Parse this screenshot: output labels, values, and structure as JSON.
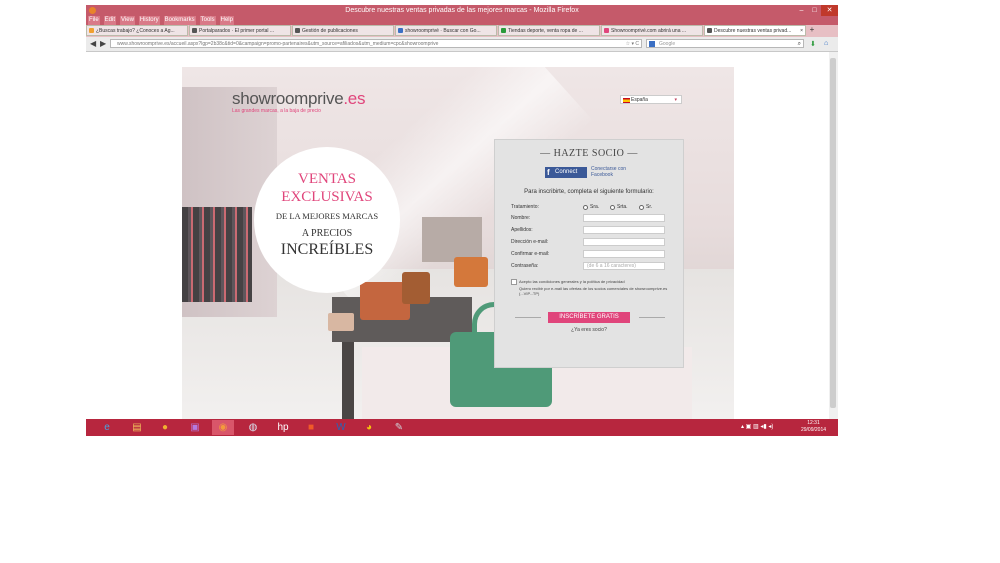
{
  "window": {
    "title": "Descubre nuestras ventas privadas de las mejores marcas - Mozilla Firefox",
    "controls": {
      "minimize": "–",
      "maximize": "□",
      "close": "✕"
    }
  },
  "menu": [
    "File",
    "Edit",
    "View",
    "History",
    "Bookmarks",
    "Tools",
    "Help"
  ],
  "tabs": [
    {
      "label": "¿Buscas trabajo? ¿Conoces a Ag...",
      "icon_color": "#f0a030",
      "active": false
    },
    {
      "label": "Portalparados · El primer portal ...",
      "icon_color": "#555555",
      "active": false
    },
    {
      "label": "Gestión de publicaciones",
      "icon_color": "#555555",
      "active": false
    },
    {
      "label": "showroomprivé · Buscar con Go...",
      "icon_color": "#3b6fc4",
      "active": false
    },
    {
      "label": "Tiendas deporte, venta ropa de ...",
      "icon_color": "#2a9a3a",
      "active": false
    },
    {
      "label": "Showroomprivé.com abrirá una ...",
      "icon_color": "#e0457b",
      "active": false
    },
    {
      "label": "Descubre nuestras ventas privad...",
      "icon_color": "#555555",
      "active": true
    }
  ],
  "tab_close": "×",
  "tab_new": "+",
  "nav": {
    "back": "◀",
    "forward": "▶",
    "url": "www.showroomprive.es/accueil.aspx?lgp=2b38c&tid=0&campaign=promo-partenaires&utm_source=afiliados&utm_medium=cpc&showroomprive",
    "url_right": "☆ ▾ C",
    "search_placeholder": "Google",
    "search_icon": "magnifier-icon",
    "magnifier": "⌕",
    "download": "⬇",
    "home": "⌂"
  },
  "page": {
    "logo_text": "showroomprive",
    "logo_suffix": ".es",
    "logo_tagline": "Las grandes marcas, a la baja de precio",
    "language": "España",
    "language_caret": "▾",
    "promo": {
      "line1": "VENTAS",
      "line2": "EXCLUSIVAS",
      "line3": "DE LA MEJORES MARCAS",
      "line4": "A PRECIOS",
      "line5": "INCREÍBLES"
    },
    "signup": {
      "title": "— HAZTE SOCIO —",
      "fb_icon": "f",
      "fb_button": "Connect",
      "fb_text": "Conectarse con Facebook",
      "subtitle": "Para inscribirte, completa el siguiente formulario:",
      "treatment_label": "Tratamiento:",
      "treatment_options": [
        "Sra.",
        "Srta.",
        "Sr."
      ],
      "name_label": "Nombre:",
      "surname_label": "Apellidos:",
      "email_label": "Dirección e-mail:",
      "email_confirm_label": "Confirmar e-mail:",
      "password_label": "Contraseña:",
      "password_placeholder": "(de 6 a 16 caracteres)",
      "legal_text": "Acepto las condiciones generales y la política de privacidad",
      "promo_text": "Quiero recibir por e-mail las ofertas de los socios comerciales de showroomprive.es (...VIP...TP)",
      "submit": "INSCRÍBETE GRATIS",
      "member_link": "¿Ya eres socio?"
    }
  },
  "taskbar": {
    "apps": [
      {
        "name": "ie-icon",
        "glyph": "e",
        "color": "#4aa3df"
      },
      {
        "name": "explorer-icon",
        "glyph": "▤",
        "color": "#f2c55c"
      },
      {
        "name": "media-icon",
        "glyph": "●",
        "color": "#f0b030"
      },
      {
        "name": "chat-icon",
        "glyph": "▣",
        "color": "#b57adf"
      },
      {
        "name": "firefox-icon",
        "glyph": "◉",
        "color": "#f39a3d"
      },
      {
        "name": "steam-icon",
        "glyph": "◍",
        "color": "#d9e3ef"
      },
      {
        "name": "hp-icon",
        "glyph": "hp",
        "color": "#ffffff"
      },
      {
        "name": "office-icon",
        "glyph": "■",
        "color": "#f05a28"
      },
      {
        "name": "word-icon",
        "glyph": "W",
        "color": "#2b63b5"
      },
      {
        "name": "chrome-icon",
        "glyph": "◕",
        "color": "#f4c20d"
      },
      {
        "name": "tools-icon",
        "glyph": "✎",
        "color": "#cfd4da"
      }
    ],
    "tray": "▴ ▣ ▥ ◂▮ ◂)",
    "time": "12:31",
    "date": "29/09/2014"
  }
}
